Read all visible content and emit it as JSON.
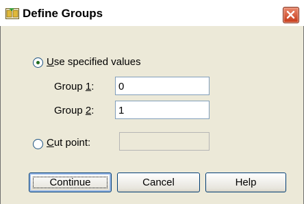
{
  "window": {
    "title": "Define Groups",
    "icon": "define-groups-app-icon",
    "close_icon": "close-icon"
  },
  "options": {
    "use_specified": {
      "label": "Use specified values",
      "mnemonic": "U",
      "selected": true
    },
    "cut_point": {
      "label": "Cut point:",
      "mnemonic": "C",
      "selected": false,
      "value": ""
    }
  },
  "group1": {
    "label": "Group 1:",
    "value": "0"
  },
  "group2": {
    "label": "Group 2:",
    "value": "1"
  },
  "buttons": {
    "continue": "Continue",
    "cancel": "Cancel",
    "help": "Help"
  },
  "colors": {
    "dialog_bg": "#ece9d8",
    "titlebar_bg": "#ffffff",
    "close_red": "#c63a18",
    "radio_dot": "#1f6b1f"
  }
}
